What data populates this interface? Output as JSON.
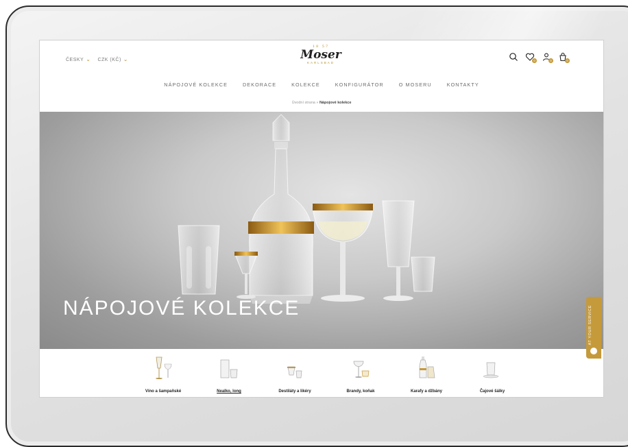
{
  "header": {
    "language": "ČESKY",
    "currency": "CZK (KČ)",
    "logo": {
      "year": "18 57",
      "name": "Moser",
      "sub": "KARLSBAD"
    }
  },
  "icons": [
    {
      "name": "search-icon",
      "badge": ""
    },
    {
      "name": "wishlist-icon",
      "badge": "0"
    },
    {
      "name": "account-icon",
      "badge": "0"
    },
    {
      "name": "cart-icon",
      "badge": "0"
    }
  ],
  "nav": [
    "NÁPOJOVÉ KOLEKCE",
    "DEKORACE",
    "KOLEKCE",
    "KONFIGURÁTOR",
    "O MOSERU",
    "KONTAKTY"
  ],
  "breadcrumb": {
    "home": "Úvodní strana",
    "separator": "»",
    "current": "Nápojové kolekce"
  },
  "hero": {
    "title": "NÁPOJOVÉ KOLEKCE",
    "service_tab": "AT YOUR SERVICE"
  },
  "categories": [
    {
      "label": "Víno a šampaňské",
      "active": false
    },
    {
      "label": "Nealko, long",
      "active": true
    },
    {
      "label": "Destiláty a likéry",
      "active": false
    },
    {
      "label": "Brandy, koňak",
      "active": false
    },
    {
      "label": "Karafy a džbány",
      "active": false
    },
    {
      "label": "Čajové šálky",
      "active": false
    }
  ],
  "colors": {
    "gold": "#c59a3a",
    "text": "#6b6b6b"
  }
}
